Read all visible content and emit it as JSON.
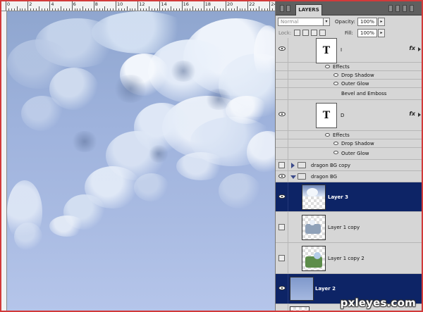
{
  "ruler": {
    "numbers": [
      "0",
      "2",
      "4",
      "6",
      "8",
      "10",
      "12",
      "14",
      "16",
      "18",
      "20",
      "22",
      "24"
    ]
  },
  "panel": {
    "tab_label": "LAYERS",
    "blend_mode": "Normal",
    "opacity_label": "Opacity:",
    "opacity_value": "100%",
    "lock_label": "Lock:",
    "fill_label": "Fill:",
    "fill_value": "100%"
  },
  "layers": {
    "text_layer_1": {
      "thumb_letter": "T",
      "name": "I",
      "fx": "fx",
      "effects_label": "Effects",
      "effects": [
        "Drop Shadow",
        "Outer Glow",
        "Bevel and Emboss"
      ]
    },
    "text_layer_2": {
      "thumb_letter": "T",
      "name": "D",
      "fx": "fx",
      "effects_label": "Effects",
      "effects": [
        "Drop Shadow",
        "Outer Glow"
      ]
    },
    "group_1": {
      "name": "dragon BG copy"
    },
    "group_2": {
      "name": "dragon BG"
    },
    "layer_3": {
      "name": "Layer 3"
    },
    "layer_1_copy": {
      "name": "Layer 1 copy"
    },
    "layer_1_copy_2": {
      "name": "Layer 1 copy 2"
    },
    "layer_2": {
      "name": "Layer 2"
    }
  },
  "colors": {
    "selection": "#0d2466",
    "sky": "#9fb3dd",
    "frame": "#d23a3a"
  },
  "watermark": "pxleyes.com"
}
